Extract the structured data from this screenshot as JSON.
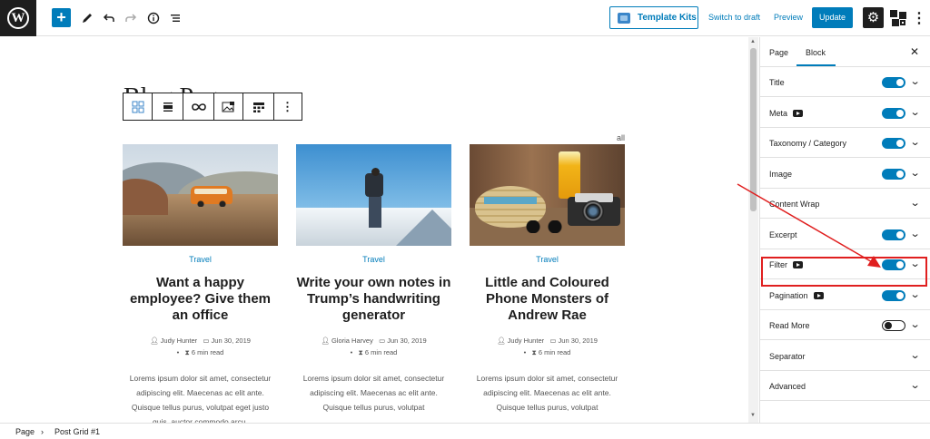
{
  "topbar": {
    "template_kits_label": "Template Kits",
    "switch_to_draft_label": "Switch to draft",
    "preview_label": "Preview",
    "update_label": "Update",
    "add_icon": "plus-icon",
    "brush_icon": "pencil-icon",
    "undo_icon": "undo-icon",
    "redo_icon": "redo-icon",
    "info_icon": "info-icon",
    "list_icon": "list-view-icon",
    "settings_icon": "gear-icon"
  },
  "canvas": {
    "page_title": "Blog Page",
    "filter_all": "all",
    "cards": [
      {
        "category": "Travel",
        "title": "Want a happy employee? Give them an office",
        "author": "Judy Hunter",
        "date": "Jun 30, 2019",
        "read_time": "6 min read",
        "excerpt": "Lorems ipsum dolor sit amet, consectetur adipiscing elit. Maecenas ac elit ante. Quisque tellus purus, volutpat eget justo quis, auctor commodo arcu."
      },
      {
        "category": "Travel",
        "title": "Write your own notes in Trump’s handwriting generator",
        "author": "Gloria Harvey",
        "date": "Jun 30, 2019",
        "read_time": "6 min read",
        "excerpt": "Lorems ipsum dolor sit amet, consectetur adipiscing elit. Maecenas ac elit ante. Quisque tellus purus, volutpat"
      },
      {
        "category": "Travel",
        "title": "Little and Coloured Phone Monsters of Andrew Rae",
        "author": "Judy Hunter",
        "date": "Jun 30, 2019",
        "read_time": "6 min read",
        "excerpt": "Lorems ipsum dolor sit amet, consectetur adipiscing elit. Maecenas ac elit ante. Quisque tellus purus, volutpat"
      }
    ]
  },
  "sidebar": {
    "tabs": [
      "Page",
      "Block"
    ],
    "active_tab": "Block",
    "close_label": "✕",
    "panels": [
      {
        "label": "Title",
        "toggle": "on",
        "video": false
      },
      {
        "label": "Meta",
        "toggle": "on",
        "video": true
      },
      {
        "label": "Taxonomy / Category",
        "toggle": "on",
        "video": false
      },
      {
        "label": "Image",
        "toggle": "on",
        "video": false
      },
      {
        "label": "Content Wrap",
        "toggle": "none",
        "video": false
      },
      {
        "label": "Excerpt",
        "toggle": "on",
        "video": false
      },
      {
        "label": "Filter",
        "toggle": "on",
        "video": true
      },
      {
        "label": "Pagination",
        "toggle": "on",
        "video": true
      },
      {
        "label": "Read More",
        "toggle": "off",
        "video": false
      },
      {
        "label": "Separator",
        "toggle": "none",
        "video": false
      },
      {
        "label": "Advanced",
        "toggle": "none",
        "video": false
      }
    ]
  },
  "footer": {
    "crumb1": "Page",
    "separator": "›",
    "crumb2": "Post Grid #1"
  },
  "colors": {
    "accent": "#007cba",
    "highlight": "#e01f1f"
  }
}
